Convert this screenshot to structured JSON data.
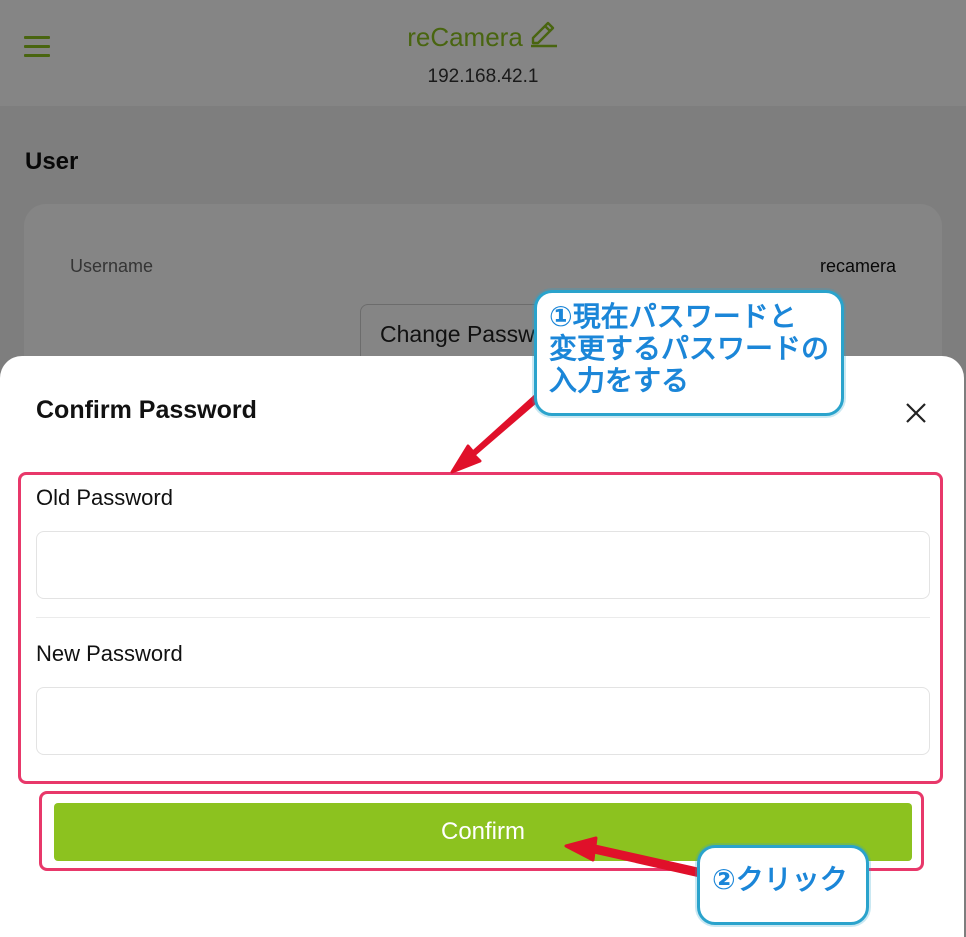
{
  "header": {
    "title": "reCamera",
    "ip": "192.168.42.1"
  },
  "user_section": {
    "title": "User",
    "username_label": "Username",
    "username_value": "recamera",
    "change_button_label": "Change Password"
  },
  "dialog": {
    "title": "Confirm Password",
    "old_password_label": "Old Password",
    "old_password_value": "",
    "new_password_label": "New Password",
    "new_password_value": "",
    "confirm_label": "Confirm"
  },
  "annotations": {
    "callout1_lines": [
      "①現在パスワードと",
      "変更するパスワードの",
      "入力をする"
    ],
    "callout2_text": "②クリック",
    "highlight_color": "#e8386a",
    "callout_border_color": "#2aa3cc",
    "callout_text_color": "#1b86d8",
    "arrow_color": "#e0102a"
  },
  "colors": {
    "accent": "#8cc21f"
  },
  "icons": {
    "menu": "hamburger-menu-icon",
    "edit": "pencil-icon",
    "close": "close-icon"
  }
}
